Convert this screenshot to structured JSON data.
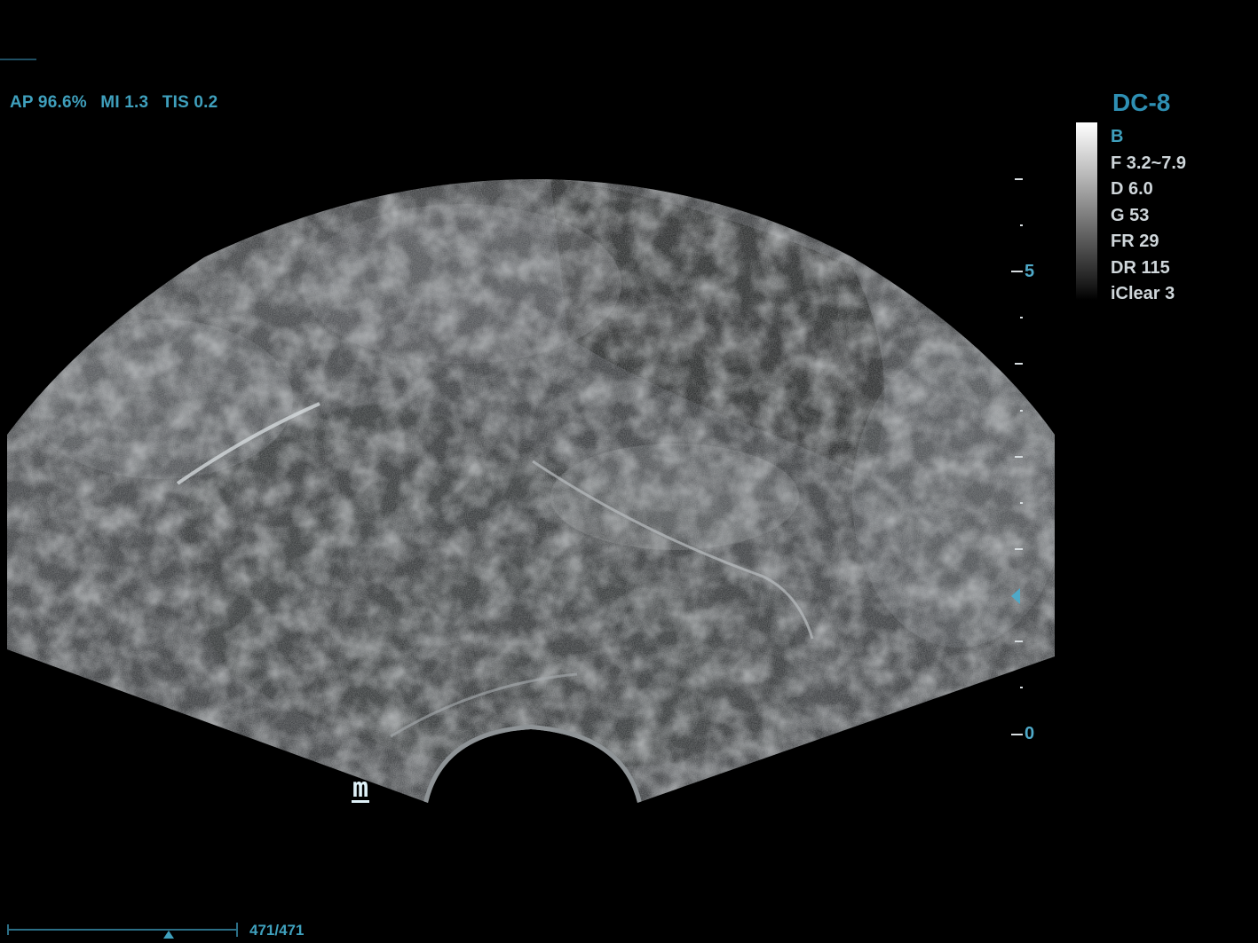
{
  "acoustic_output": {
    "ap": "AP 96.6%",
    "mi": "MI 1.3",
    "tis": "TIS 0.2"
  },
  "probe": "DC-8",
  "imaging_params": {
    "mode": "B",
    "frequency": "F 3.2~7.9",
    "depth": "D 6.0",
    "gain": "G 53",
    "frame_rate": "FR 29",
    "dynamic_range": "DR 115",
    "iclear": "iClear 3"
  },
  "depth_scale": {
    "top_label": "5",
    "bottom_label": "0"
  },
  "orientation_marker": "m",
  "cine": {
    "frame_count": "471/471"
  }
}
